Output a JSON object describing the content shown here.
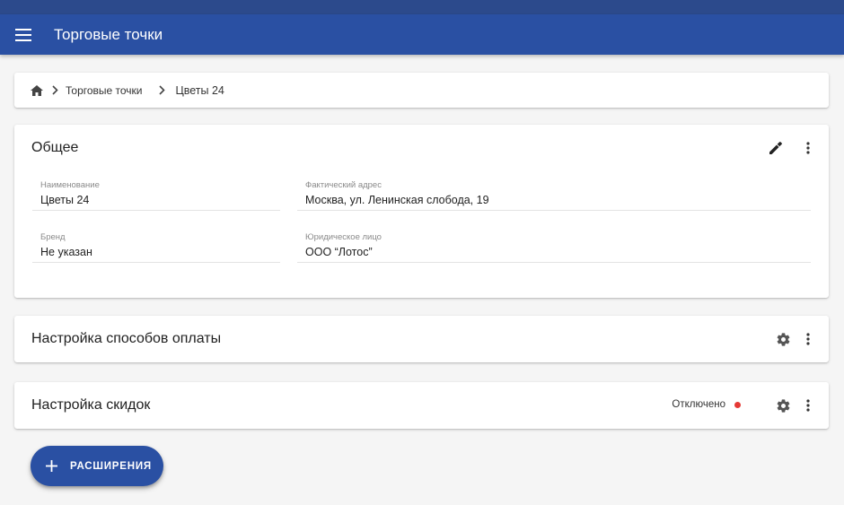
{
  "app": {
    "title": "Торговые точки",
    "accent_color": "#2a50a3"
  },
  "breadcrumb": {
    "home_icon": "home-icon",
    "items": [
      "Торговые точки",
      "Цветы 24"
    ]
  },
  "general": {
    "title": "Общее",
    "actions": [
      "edit-icon",
      "more-vert-icon"
    ],
    "fields": {
      "name": {
        "label": "Наименование",
        "value": "Цветы 24"
      },
      "address": {
        "label": "Фактический адрес",
        "value": "Москва, ул. Ленинская слобода, 19"
      },
      "brand": {
        "label": "Бренд",
        "value": "Не указан"
      },
      "legal": {
        "label": "Юридическое лицо",
        "value": "ООО “Лотос”"
      }
    }
  },
  "payments": {
    "title": "Настройка способов оплаты",
    "actions": [
      "gear-icon",
      "more-vert-icon"
    ]
  },
  "discounts": {
    "title": "Настройка скидок",
    "status": "Отключено",
    "status_color": "#e53935",
    "actions": [
      "gear-icon",
      "more-vert-icon"
    ]
  },
  "fab": {
    "label": "РАСШИРЕНИЯ",
    "icon": "plus-icon"
  }
}
